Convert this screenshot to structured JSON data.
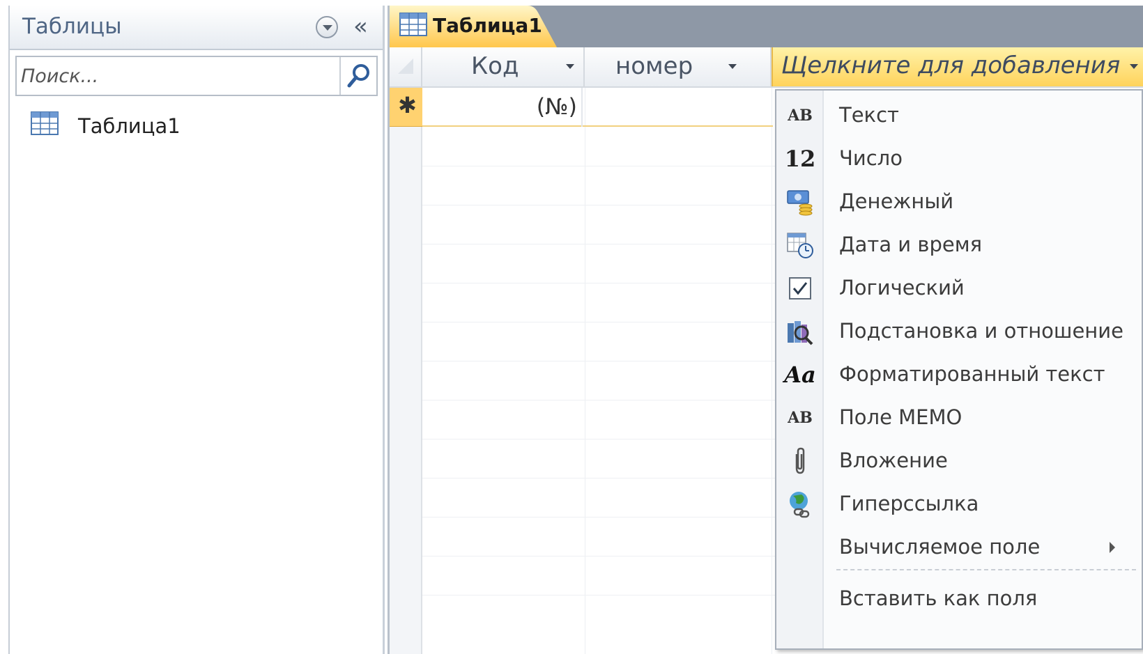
{
  "nav": {
    "title": "Таблицы",
    "search_placeholder": "Поиск...",
    "items": [
      {
        "label": "Таблица1"
      }
    ]
  },
  "tabs": [
    {
      "label": "Таблица1",
      "active": true
    }
  ],
  "grid": {
    "columns": [
      {
        "label": "Код"
      },
      {
        "label": "номер"
      }
    ],
    "add_column_label": "Щелкните для добавления",
    "new_row": {
      "marker": "✱",
      "id_placeholder": "(№)"
    }
  },
  "field_type_menu": {
    "items": [
      {
        "icon": "text-type-icon",
        "label": "Текст"
      },
      {
        "icon": "number-type-icon",
        "label": "Число"
      },
      {
        "icon": "currency-type-icon",
        "label": "Денежный"
      },
      {
        "icon": "datetime-type-icon",
        "label": "Дата и время"
      },
      {
        "icon": "checkbox-type-icon",
        "label": "Логический"
      },
      {
        "icon": "lookup-type-icon",
        "label": "Подстановка и отношение"
      },
      {
        "icon": "rich-text-type-icon",
        "label": "Форматированный текст"
      },
      {
        "icon": "memo-type-icon",
        "label": "Поле MEMO"
      },
      {
        "icon": "attachment-type-icon",
        "label": "Вложение"
      },
      {
        "icon": "hyperlink-type-icon",
        "label": "Гиперссылка"
      },
      {
        "icon": "",
        "label": "Вычисляемое поле",
        "has_submenu": true
      },
      {
        "icon": "",
        "label": "Вставить как поля"
      }
    ],
    "icon_text": {
      "ab": "AB",
      "twelve": "12",
      "aa": "Aa"
    }
  },
  "colors": {
    "accent_orange": "#ffd35c",
    "nav_title": "#4f6685",
    "tabbar": "#8e98a6"
  }
}
